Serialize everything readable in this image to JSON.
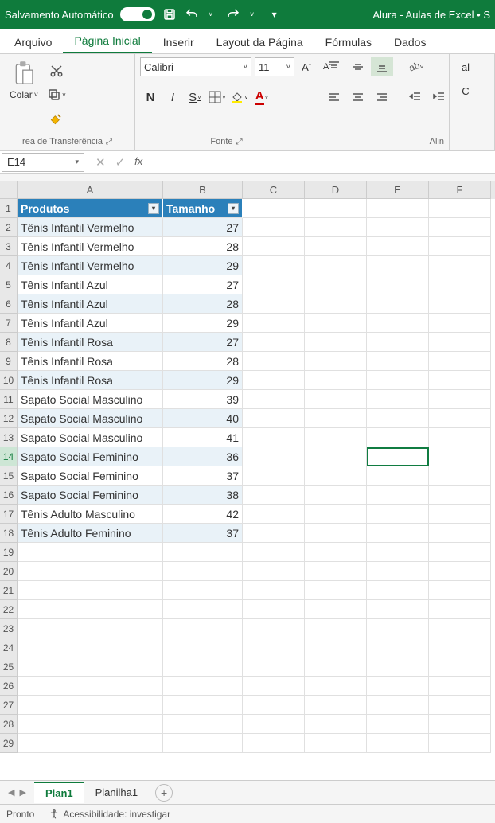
{
  "titlebar": {
    "autosave": "Salvamento Automático",
    "document": "Alura - Aulas de Excel • S"
  },
  "tabs": {
    "arquivo": "Arquivo",
    "pagina_inicial": "Página Inicial",
    "inserir": "Inserir",
    "layout": "Layout da Página",
    "formulas": "Fórmulas",
    "dados": "Dados"
  },
  "ribbon": {
    "clip_caption": "Colar",
    "clip_group": "rea de Transferência",
    "font_name": "Calibri",
    "font_size": "11",
    "bold": "N",
    "italic": "I",
    "underline": "S",
    "font_group_label": "Fonte",
    "align_group_label": "Alin",
    "num_left": "al",
    "num_right": "C"
  },
  "namebox": "E14",
  "columns": [
    "A",
    "B",
    "C",
    "D",
    "E",
    "F"
  ],
  "table": {
    "headers": {
      "produtos": "Produtos",
      "tamanho": "Tamanho"
    },
    "rows": [
      {
        "p": "Tênis Infantil Vermelho",
        "t": "27"
      },
      {
        "p": "Tênis Infantil Vermelho",
        "t": "28"
      },
      {
        "p": "Tênis Infantil Vermelho",
        "t": "29"
      },
      {
        "p": "Tênis Infantil Azul",
        "t": "27"
      },
      {
        "p": "Tênis Infantil Azul",
        "t": "28"
      },
      {
        "p": "Tênis Infantil Azul",
        "t": "29"
      },
      {
        "p": "Tênis Infantil Rosa",
        "t": "27"
      },
      {
        "p": "Tênis Infantil Rosa",
        "t": "28"
      },
      {
        "p": "Tênis Infantil Rosa",
        "t": "29"
      },
      {
        "p": "Sapato Social Masculino",
        "t": "39"
      },
      {
        "p": "Sapato Social Masculino",
        "t": "40"
      },
      {
        "p": "Sapato Social Masculino",
        "t": "41"
      },
      {
        "p": "Sapato Social Feminino",
        "t": "36"
      },
      {
        "p": "Sapato Social Feminino",
        "t": "37"
      },
      {
        "p": "Sapato Social Feminino",
        "t": "38"
      },
      {
        "p": "Tênis Adulto Masculino",
        "t": "42"
      },
      {
        "p": "Tênis Adulto Feminino",
        "t": "37"
      }
    ]
  },
  "sheets": {
    "active": "Plan1",
    "other": "Planilha1"
  },
  "status": {
    "pronto": "Pronto",
    "acess": "Acessibilidade: investigar"
  }
}
